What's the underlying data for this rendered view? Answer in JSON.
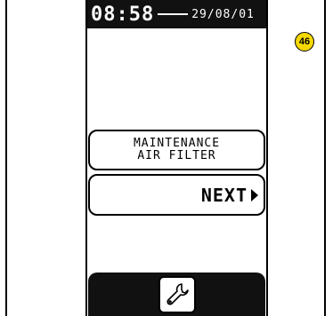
{
  "status_bar": {
    "time": "08:58",
    "date": "29/08/01"
  },
  "menu": {
    "maintenance_line1": "MAINTENANCE",
    "maintenance_line2": "AIR FILTER",
    "next_label": "NEXT"
  },
  "toolbar": {
    "tool_icon": "wrench-icon"
  },
  "badge": {
    "number": "46"
  },
  "colors": {
    "screen_dark": "#111111",
    "badge_fill": "#f5d800"
  }
}
